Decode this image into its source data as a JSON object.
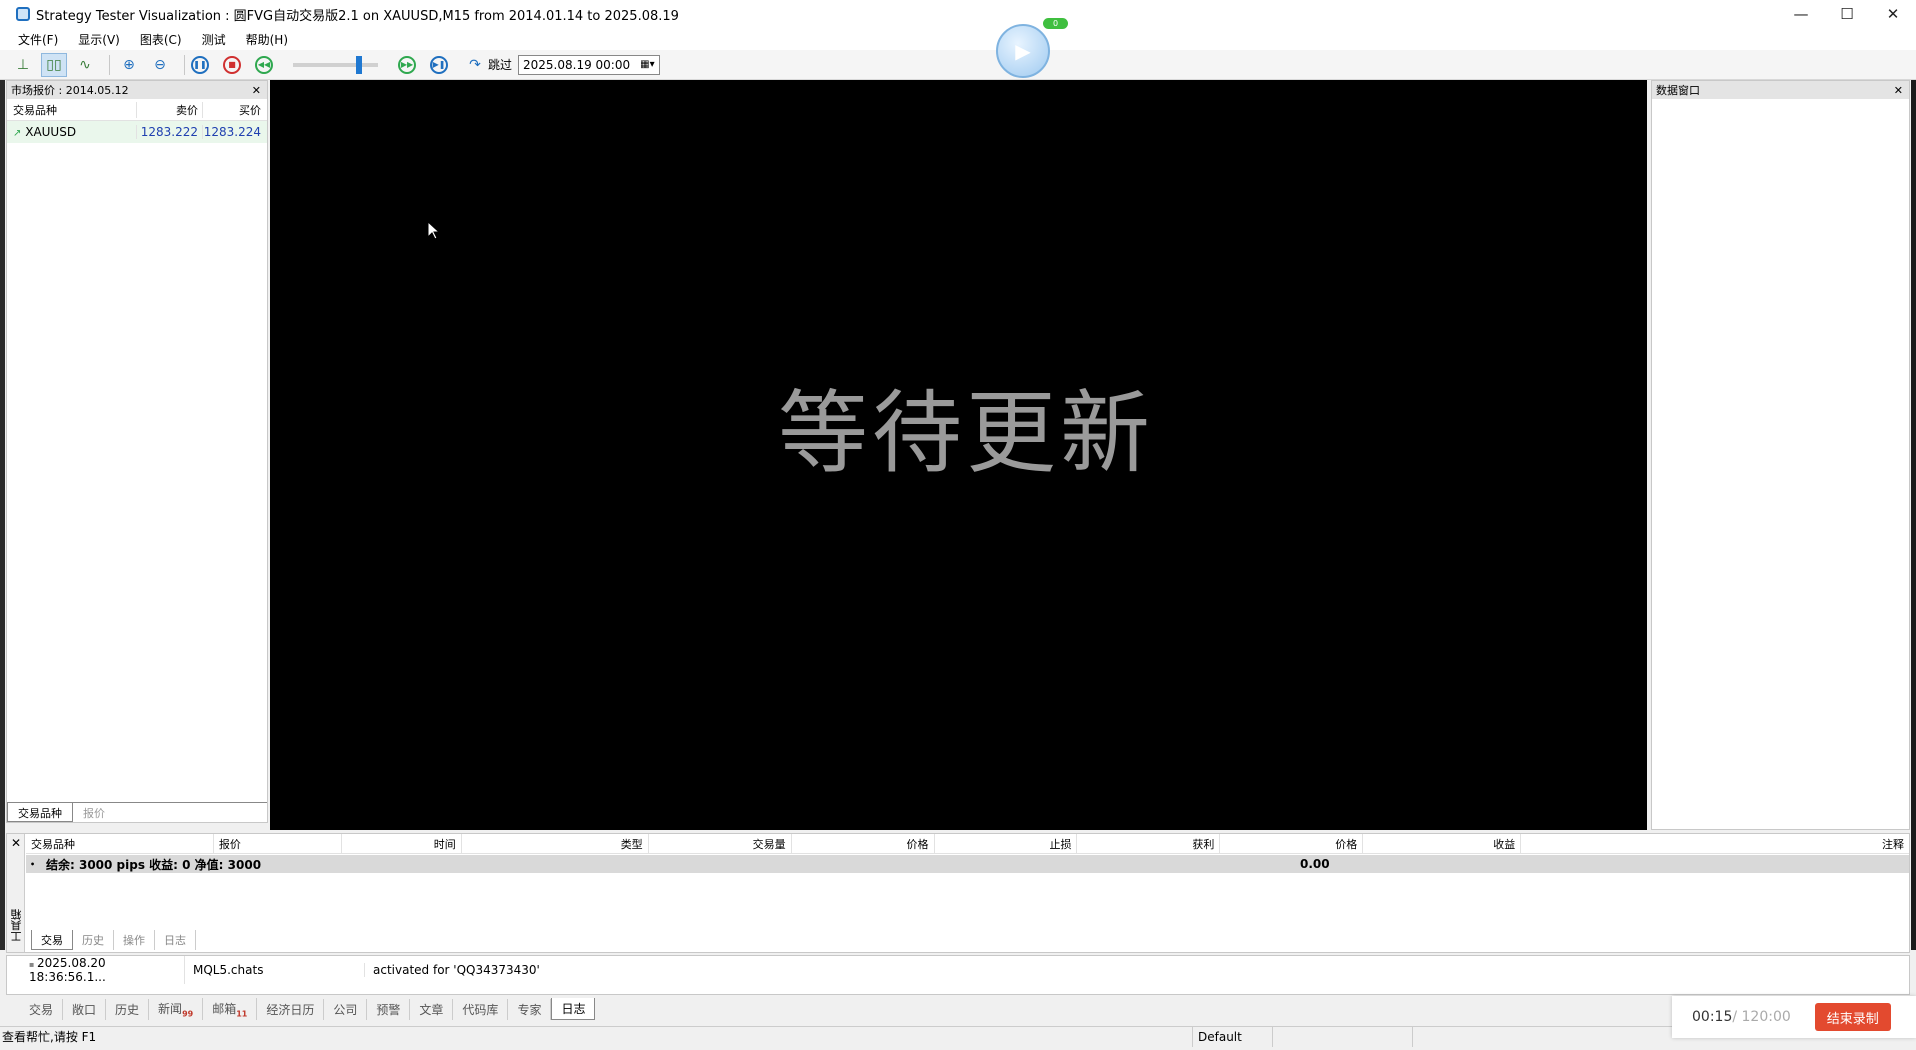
{
  "window": {
    "title": "Strategy Tester Visualization : 圆FVG自动交易版2.1 on XAUUSD,M15 from 2014.01.14 to 2025.08.19",
    "minimize": "—",
    "maximize": "☐",
    "close": "✕"
  },
  "menu": [
    "文件(F)",
    "显示(V)",
    "图表(C)",
    "测试",
    "帮助(H)"
  ],
  "toolbar": {
    "skip_label": "跳过",
    "date_value": "2025.08.19 00:00",
    "slider_level": 0.74,
    "play_badge": "0"
  },
  "market_watch": {
    "title": "市场报价 : 2014.05.12",
    "columns": [
      "交易品种",
      "卖价",
      "买价"
    ],
    "rows": [
      {
        "symbol": "XAUUSD",
        "bid": "1283.222",
        "ask": "1283.224"
      }
    ],
    "tabs": [
      "交易品种",
      "报价"
    ]
  },
  "chart": {
    "wait_text": "等待更新"
  },
  "data_window": {
    "title": "数据窗口"
  },
  "toolbox": {
    "side_label": "工具箱",
    "columns": [
      "交易品种",
      "报价",
      "时间",
      "类型",
      "交易量",
      "价格",
      "止损",
      "获利",
      "价格",
      "收益",
      "注释"
    ],
    "summary": "结余: 3000 pips   收益: 0   净值: 3000",
    "summary_profit": "0.00",
    "tabs": [
      "交易",
      "历史",
      "操作",
      "日志"
    ]
  },
  "journal": {
    "time": "2025.08.20 18:36:56.1...",
    "source": "MQL5.chats",
    "message": "activated for 'QQ34373430'"
  },
  "bottom_tabs": [
    {
      "label": "交易",
      "badge": ""
    },
    {
      "label": "敞口",
      "badge": ""
    },
    {
      "label": "历史",
      "badge": ""
    },
    {
      "label": "新闻",
      "badge": "99"
    },
    {
      "label": "邮箱",
      "badge": "11"
    },
    {
      "label": "经济日历",
      "badge": ""
    },
    {
      "label": "公司",
      "badge": ""
    },
    {
      "label": "预警",
      "badge": ""
    },
    {
      "label": "文章",
      "badge": ""
    },
    {
      "label": "代码库",
      "badge": ""
    },
    {
      "label": "专家",
      "badge": ""
    },
    {
      "label": "日志",
      "badge": ""
    }
  ],
  "status": {
    "help": "查看帮忙,请按 F1",
    "profile": "Default"
  },
  "recording": {
    "elapsed": "00:15",
    "total": " / 120:00",
    "stop_label": "结束录制"
  }
}
